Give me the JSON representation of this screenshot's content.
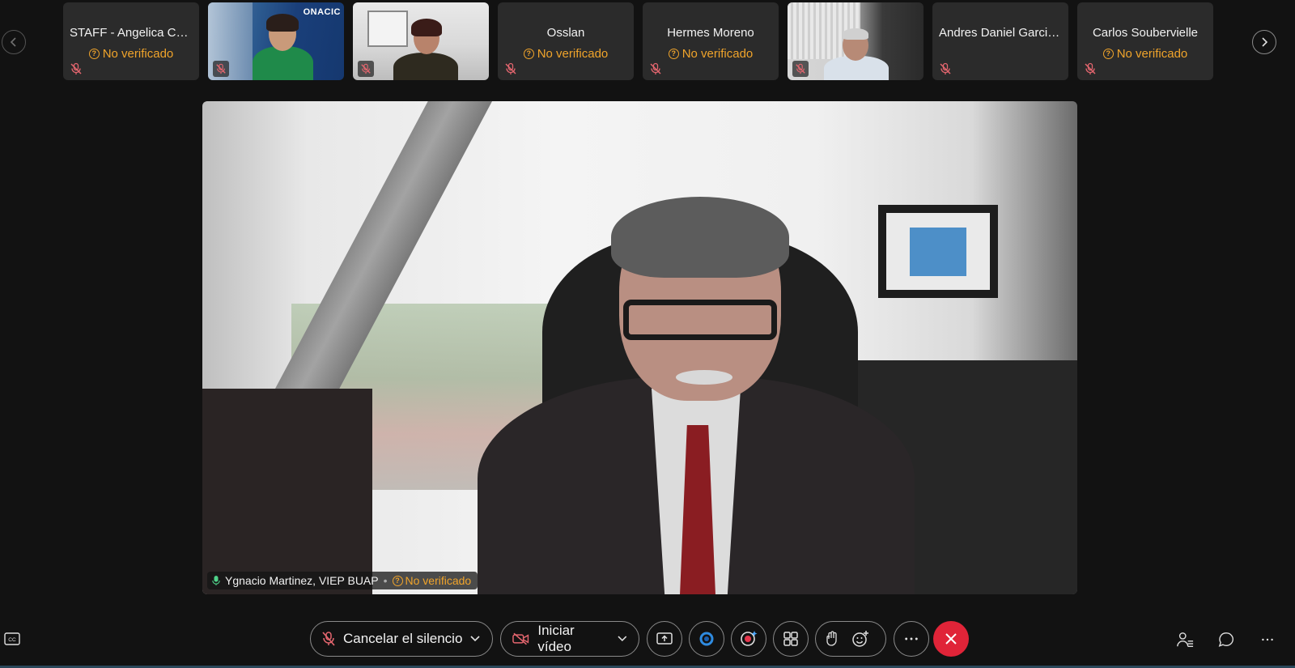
{
  "participants": [
    {
      "name": "STAFF - Angelica Cort...",
      "status": "No verificado",
      "video": false
    },
    {
      "name": "",
      "status": "",
      "video": true,
      "logo_text": "ONACIC"
    },
    {
      "name": "",
      "status": "",
      "video": true
    },
    {
      "name": "Osslan",
      "status": "No verificado",
      "video": false
    },
    {
      "name": "Hermes Moreno",
      "status": "No verificado",
      "video": false
    },
    {
      "name": "",
      "status": "",
      "video": true
    },
    {
      "name": "Andres Daniel Garcia ...",
      "status": "",
      "video": false
    },
    {
      "name": "Carlos Soubervielle",
      "status": "No verificado",
      "video": false
    }
  ],
  "main_speaker": {
    "name": "Ygnacio Martinez, VIEP BUAP",
    "separator": "•",
    "status": "No verificado"
  },
  "toolbar": {
    "unmute_label": "Cancelar el silencio",
    "start_video_label": "Iniciar vídeo",
    "share_icon": "share-screen-icon",
    "apps_icon": "webex-apps-icon",
    "record_icon": "record-icon",
    "layout_icon": "layout-grid-icon",
    "raise_hand_icon": "raise-hand-icon",
    "reactions_icon": "reactions-icon",
    "more_icon": "more-options-icon",
    "end_icon": "end-call-icon"
  },
  "colors": {
    "background": "#121212",
    "tile_bg": "#2b2b2b",
    "warning": "#f0a42b",
    "mute_red": "#e5666f",
    "end_call": "#e02438"
  }
}
